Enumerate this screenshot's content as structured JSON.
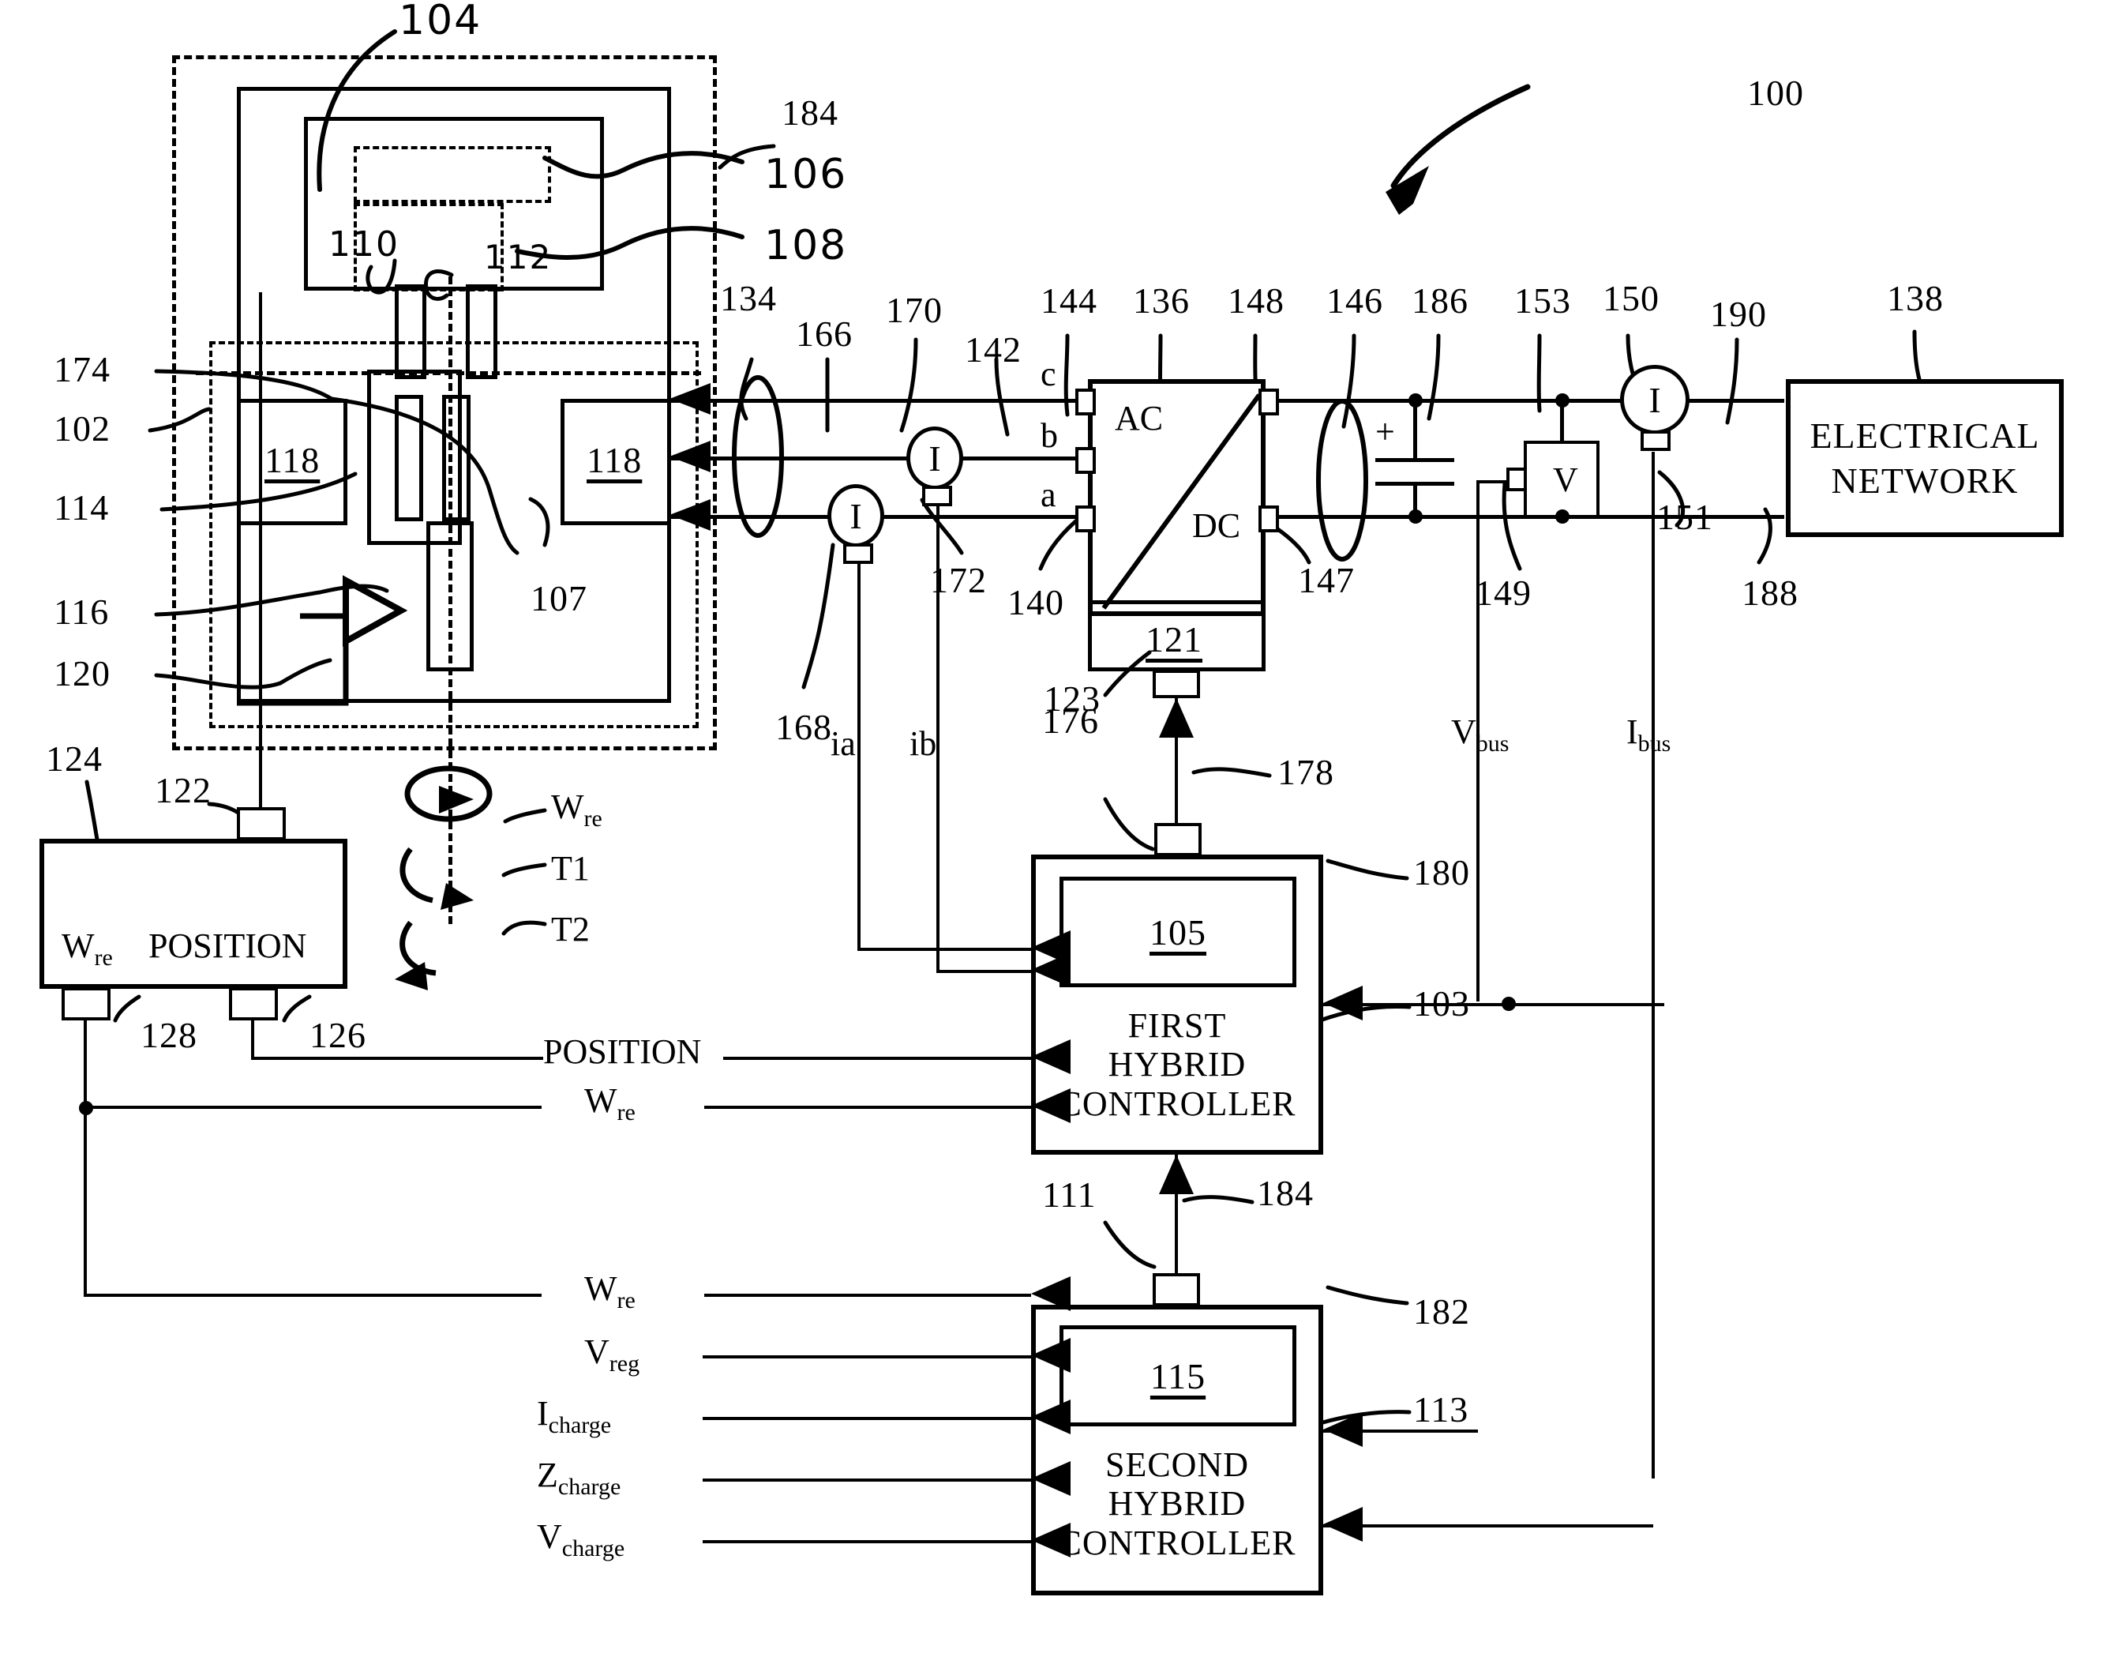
{
  "figure": {
    "number": "100",
    "type": "patent-schematic",
    "title": "Hybrid electrical generation / conversion system block diagram"
  },
  "reference_numerals": {
    "system": "100",
    "generator_assembly": "102",
    "first_controller_link": "103",
    "machine": "104",
    "first_controller_module": "105",
    "rotor_detail_a": "106",
    "exciter": "107",
    "rotor_detail_b": "108",
    "rotor_inner_a": "110",
    "second_controller_link_line": "111",
    "rotor_inner_b": "112",
    "second_controller_link": "113",
    "stator_core": "114",
    "second_controller_module": "115",
    "field_winding": "116",
    "windings": "118",
    "rotor_shaft_arrow": "120",
    "converter_module": "121",
    "position_sensor_mount": "122",
    "converter_command_line": "123",
    "position_sensor": "124",
    "position_output": "126",
    "speed_output": "128",
    "bus_left": "134",
    "converter": "136",
    "electrical_network": "138",
    "converter_ac_terminal_a": "140",
    "phase_label_group": "142",
    "converter_ac_terminal_c": "144",
    "dc_bus": "146",
    "converter_dc_terminal_neg": "147",
    "converter_dc_terminal_pos": "148",
    "voltmeter_link": "149",
    "bus_ammeter": "150",
    "ammeter_link": "151",
    "voltmeter": "153",
    "phase_line_a": "166",
    "ammeter_b": "168",
    "phase_line_b": "170",
    "ammeter_b_output": "172",
    "feedback_line_to_converter": "176",
    "feedback_line": "178",
    "first_hybrid_controller": "180",
    "second_hybrid_controller": "182",
    "enclosure_boundary": "184",
    "dc_capacitor": "186",
    "network_return": "188",
    "network_feed": "190",
    "winding_tap": "174"
  },
  "callouts": {
    "c100": "100",
    "c104": "104",
    "c184a": "184",
    "c106": "106",
    "c108": "108",
    "c110": "110",
    "c112": "112",
    "c174": "174",
    "c102": "102",
    "c114": "114",
    "c116": "116",
    "c120": "120",
    "c107": "107",
    "c118a": "118",
    "c118b": "118",
    "c124": "124",
    "c122": "122",
    "c128": "128",
    "c126": "126",
    "c134": "134",
    "c166": "166",
    "c170": "170",
    "c142": "142",
    "c144": "144",
    "c136": "136",
    "c148": "148",
    "c146": "146",
    "c186": "186",
    "c153": "153",
    "c150": "150",
    "c190": "190",
    "c138": "138",
    "c168": "168",
    "c172": "172",
    "c140": "140",
    "c121": "121",
    "c147": "147",
    "c149": "149",
    "c151": "151",
    "c188": "188",
    "c123": "123",
    "c176": "176",
    "c178": "178",
    "c180": "180",
    "c103": "103",
    "c105": "105",
    "c111": "111",
    "c184b": "184",
    "c182": "182",
    "c113": "113",
    "c115": "115"
  },
  "blocks": {
    "converter": {
      "ac_label": "AC",
      "dc_label": "DC",
      "module_number": "121"
    },
    "electrical_network": {
      "line1": "ELECTRICAL",
      "line2": "NETWORK"
    },
    "position_sensor": {
      "speed_label": "W",
      "speed_sub": "re",
      "name": "POSITION"
    },
    "first_controller": {
      "module": "105",
      "line1": "FIRST",
      "line2": "HYBRID",
      "line3": "CONTROLLER"
    },
    "second_controller": {
      "module": "115",
      "line1": "SECOND",
      "line2": "HYBRID",
      "line3": "CONTROLLER"
    },
    "winding_left": "118",
    "winding_right": "118"
  },
  "signal_labels": {
    "phase_c": "c",
    "phase_b": "b",
    "phase_a": "a",
    "current_a": "ia",
    "current_b": "ib",
    "v_bus_main": "V",
    "v_bus_sub": "bus",
    "i_bus_main": "I",
    "i_bus_sub": "bus",
    "w_re_shaft_main": "W",
    "w_re_shaft_sub": "re",
    "torque_1": "T1",
    "torque_2": "T2",
    "position_signal": "POSITION",
    "w_re_signal_main": "W",
    "w_re_signal_sub": "re",
    "w_re_signal2_main": "W",
    "w_re_signal2_sub": "re",
    "v_reg_main": "V",
    "v_reg_sub": "reg",
    "i_charge_main": "I",
    "i_charge_sub": "charge",
    "z_charge_main": "Z",
    "z_charge_sub": "charge",
    "v_charge_main": "V",
    "v_charge_sub": "charge",
    "ammeter_glyph": "I",
    "voltmeter_glyph": "V",
    "capacitor_plus": "+"
  },
  "colors": {
    "ink": "#000000",
    "paper": "#ffffff"
  }
}
